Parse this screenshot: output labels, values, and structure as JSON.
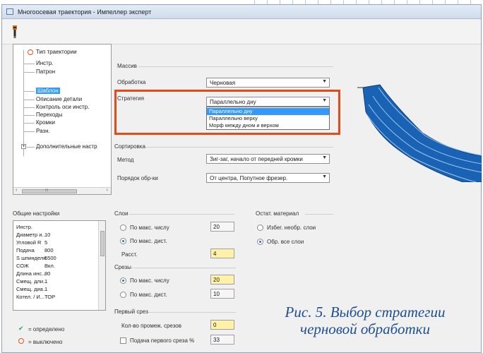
{
  "window": {
    "title": "Многоосевая траектория - Импеллер эксперт"
  },
  "tree": {
    "items": [
      {
        "label": "Тип траектории"
      },
      {
        "label": "Инстр."
      },
      {
        "label": "Патрон"
      },
      {
        "label": "Шаблон"
      },
      {
        "label": "Описание детали"
      },
      {
        "label": "Контроль оси инстр."
      },
      {
        "label": "Переходы"
      },
      {
        "label": "Кромки"
      },
      {
        "label": "Разн."
      },
      {
        "label": "Дополнительные настр"
      }
    ],
    "selected_label": "Шаблон",
    "scroll_left": "‹",
    "scroll_right": "›",
    "scroll_grip": "III"
  },
  "massiv": {
    "group_label": "Массив",
    "obrabotka_label": "Обработка",
    "obrabotka_value": "Черновая",
    "strategy_label": "Стратегия",
    "strategy_value": "Параллельно дну",
    "strategy_options": [
      "Параллельно дну",
      "Параллельно верху",
      "Морф между дном и верхом"
    ]
  },
  "sort": {
    "group_label": "Сортировка",
    "method_label": "Метод",
    "method_value": "Зиг-заг, начало от передней кромки",
    "order_label": "Порядок обр-ки",
    "order_value": "От центра, Попутное фрезер."
  },
  "general": {
    "group_label": "Общие настройки",
    "rows": [
      {
        "k": "Инстр.",
        "v": ""
      },
      {
        "k": "Диаметр и...",
        "v": "10"
      },
      {
        "k": "Угловой R",
        "v": "5"
      },
      {
        "k": "Подача",
        "v": "800"
      },
      {
        "k": "S шпинделя",
        "v": "5500"
      },
      {
        "k": "СОЖ",
        "v": "Вкл."
      },
      {
        "k": "Длина инс...",
        "v": "80"
      },
      {
        "k": "Смещ. дли...",
        "v": "1"
      },
      {
        "k": "Смещ. диа...",
        "v": "1"
      },
      {
        "k": "Котел. / И...",
        "v": "ТОР"
      }
    ]
  },
  "legend": {
    "defined": "= определено",
    "disabled": "= выключено"
  },
  "layers": {
    "group_label": "Слои",
    "by_max_count": "По макс. числу",
    "by_max_count_value": "20",
    "by_max_dist": "По макс. дист.",
    "dist_label": "Расст.",
    "dist_value": "4"
  },
  "cuts": {
    "group_label": "Срезы",
    "by_max_count": "По макс. числу",
    "by_max_count_value": "20",
    "by_max_dist": "По макс. дист.",
    "by_max_dist_value": "10"
  },
  "first_cut": {
    "group_label": "Первый срез",
    "intermediate_label": "Кол-во промеж. срезов",
    "intermediate_value": "0",
    "feed_label": "Подача первого среза %",
    "feed_value": "33"
  },
  "remaining": {
    "group_label": "Остат. материал",
    "avoid": "Избег. необр. слои",
    "process_all": "Обр. все слои"
  },
  "caption": {
    "line1": "Рис. 5. Выбор стратегии",
    "line2": "черновой обработки"
  },
  "colors": {
    "highlight": "#e8481a",
    "preview_fill": "#1a62b3",
    "caption": "#1d4f8f",
    "selection": "#3399ff"
  }
}
